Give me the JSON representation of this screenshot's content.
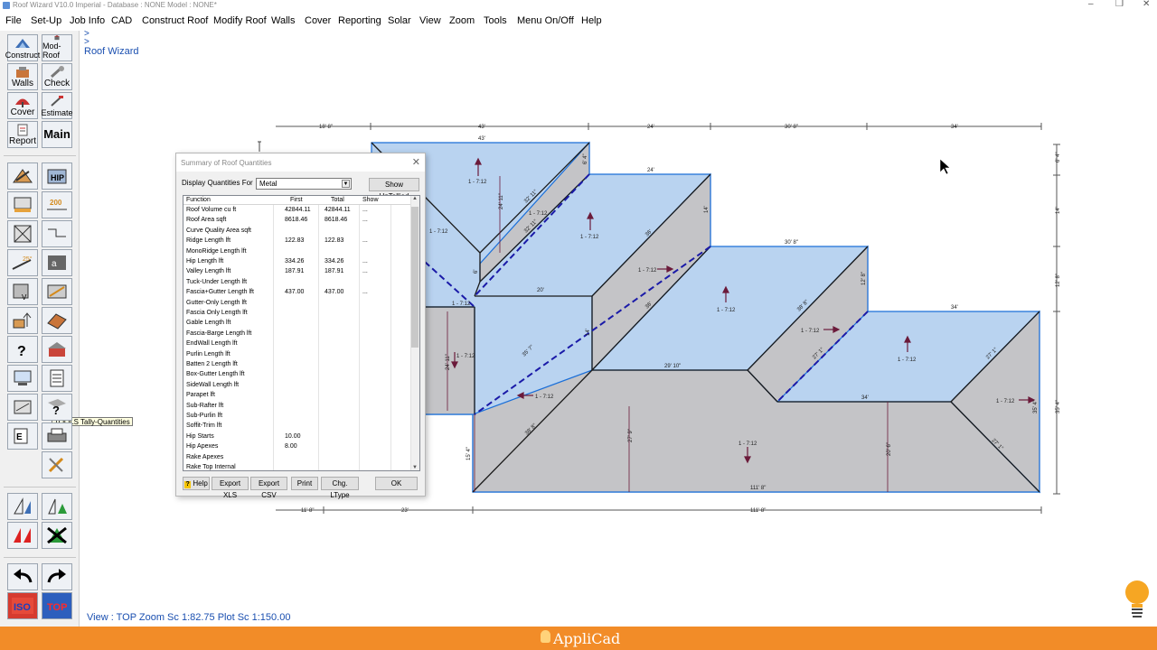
{
  "window": {
    "title": "Roof Wizard V10.0 Imperial - Database : NONE   Model : NONE*"
  },
  "menu": [
    "File",
    "Set-Up",
    "Job Info",
    "CAD",
    "Construct Roof",
    "Modify Roof",
    "Walls",
    "Cover",
    "Reporting",
    "Solar",
    "View",
    "Zoom",
    "Tools",
    "Menu On/Off",
    "Help"
  ],
  "command_area": {
    "line1": ">",
    "line2": ">",
    "line3": "Roof Wizard"
  },
  "toolbar": {
    "construct": "Construct",
    "mod_roof": "Mod-Roof",
    "walls": "Walls",
    "check": "Check",
    "cover": "Cover",
    "estimate": "Estimate",
    "report": "Report",
    "main": "Main",
    "hip": "HIP",
    "dim200": "200",
    "angle25": "25°",
    "iso": "ISO",
    "top": "TOP",
    "tooltip": "TOOLS Tally-Quantities"
  },
  "dialog": {
    "title": "Summary of Roof Quantities",
    "display_label": "Display Quantities For",
    "display_value": "Metal",
    "show_untallied": "Show UnTallied",
    "columns": [
      "Function",
      "First",
      "Total",
      "Show"
    ],
    "rows": [
      [
        "Roof Volume cu ft",
        "42844.11",
        "42844.11",
        "..."
      ],
      [
        "Roof Area sqft",
        "8618.46",
        "8618.46",
        "..."
      ],
      [
        "Curve Quality Area sqft",
        "",
        "",
        ""
      ],
      [
        "Ridge Length lft",
        "122.83",
        "122.83",
        "..."
      ],
      [
        "MonoRidge Length lft",
        "",
        "",
        ""
      ],
      [
        "Hip Length lft",
        "334.26",
        "334.26",
        "..."
      ],
      [
        "Valley Length lft",
        "187.91",
        "187.91",
        "..."
      ],
      [
        "Tuck-Under Length lft",
        "",
        "",
        ""
      ],
      [
        "Fascia+Gutter Length lft",
        "437.00",
        "437.00",
        "..."
      ],
      [
        "Gutter-Only Length lft",
        "",
        "",
        ""
      ],
      [
        "Fascia Only Length lft",
        "",
        "",
        ""
      ],
      [
        "Gable Length lft",
        "",
        "",
        ""
      ],
      [
        "Fascia-Barge Length lft",
        "",
        "",
        ""
      ],
      [
        "EndWall Length lft",
        "",
        "",
        ""
      ],
      [
        "Purlin Length lft",
        "",
        "",
        ""
      ],
      [
        "Batten 2 Length lft",
        "",
        "",
        ""
      ],
      [
        "Box-Gutter Length lft",
        "",
        "",
        ""
      ],
      [
        "SideWall Length lft",
        "",
        "",
        ""
      ],
      [
        "Parapet lft",
        "",
        "",
        ""
      ],
      [
        "Sub-Rafter lft",
        "",
        "",
        ""
      ],
      [
        "Sub-Purlin lft",
        "",
        "",
        ""
      ],
      [
        "Soffit-Trim lft",
        "",
        "",
        ""
      ],
      [
        "Hip Starts",
        "10.00",
        "",
        ""
      ],
      [
        "Hip Apexes",
        "8.00",
        "",
        ""
      ],
      [
        "Rake Apexes",
        "",
        "",
        ""
      ],
      [
        "Rake Top Internal",
        "",
        "",
        ""
      ]
    ],
    "buttons": {
      "help": "Help",
      "export_xls": "Export XLS",
      "export_csv": "Export CSV",
      "print": "Print",
      "chg_ltype": "Chg. LType",
      "ok": "OK"
    }
  },
  "drawing": {
    "top_dims": [
      "18' 8\"",
      "43'",
      "24'",
      "30' 8\"",
      "34'"
    ],
    "bottom_dims": [
      "11' 8\"",
      "23'",
      "111' 8\""
    ],
    "right_dims": [
      "6' 4\"",
      "14'",
      "12' 8\"",
      "35' 4\""
    ],
    "labels": {
      "p1": "1 - 7:12",
      "p2": "1 - 7:12",
      "p3": "1 - 7:12",
      "p4": "1 - 7:12",
      "p5": "1 - 7:12",
      "p6": "1 - 7:12",
      "p7": "1 - 7:12",
      "p8": "1 - 7:12",
      "p9": "1 - 7:12",
      "p10": "1 - 7:12",
      "p11": "1 - 7:12",
      "p12": "1 - 7:12",
      "p13": "1 - 7:12",
      "d43": "43'",
      "d24": "24'",
      "d308": "30' 8\"",
      "d34": "34'",
      "d20": "20'",
      "d2910": "29' 10\"",
      "d34b": "34'",
      "d1118": "111' 8\"",
      "d2411": "24' 11\"",
      "d2411b": "24' 11\"",
      "d279": "27' 9\"",
      "d206": "20' 6\"",
      "d154": "15' 4\"",
      "d14": "14'",
      "d14b": "14'",
      "d64": "6' 4\"",
      "d6": "6'",
      "d128": "12' 8\"",
      "d354": "35' 4\"",
      "d3211": "32' 11\"",
      "d3211b": "32' 11\"",
      "d36": "36'",
      "d36b": "36'",
      "d357": "35' 7\"",
      "d388": "38' 8\"",
      "d388b": "38' 8\"",
      "d271": "27' 1\"",
      "d271b": "27' 1\"",
      "d271c": "27' 1\""
    }
  },
  "status": {
    "text": "View : TOP  Zoom Sc 1:82.75  Plot Sc 1:150.00"
  },
  "footer": {
    "brand": "AppliCad"
  },
  "colors": {
    "roof_fill": "#b9d3f0",
    "roof_grey": "#c4c4c7",
    "roof_edge": "#1b6fd8",
    "valley": "#1a1aa8",
    "arrow": "#6b1a3a",
    "footer": "#f28c28",
    "status_text": "#1a4fb0"
  }
}
